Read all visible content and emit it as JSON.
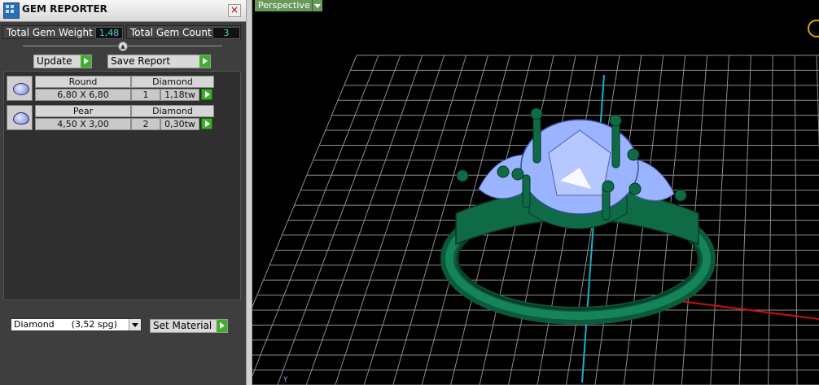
{
  "panel": {
    "title": "GEM REPORTER",
    "close_glyph": "×",
    "total_weight_label": "Total Gem Weight",
    "total_weight_value": "1,48",
    "total_count_label": "Total Gem Count",
    "total_count_value": "3",
    "update_label": "Update",
    "save_report_label": "Save Report"
  },
  "gems": [
    {
      "shape": "Round",
      "material": "Diamond",
      "size": "6,80 X 6,80",
      "count": "1",
      "weight": "1,18tw",
      "icon": "round-gem-icon"
    },
    {
      "shape": "Pear",
      "material": "Diamond",
      "size": "4,50 X 3,00",
      "count": "2",
      "weight": "0,30tw",
      "icon": "pear-gem-icon"
    }
  ],
  "material_select": {
    "selected": "Diamond      (3,52 spg)"
  },
  "set_material_label": "Set Material",
  "viewport": {
    "view_label": "Perspective",
    "axis_label": "Y",
    "grid_color": "#8c8c8c",
    "ring_color": "#0e6b45",
    "gem_color": "#9bb4ff",
    "x_axis_color": "#cc1111",
    "y_axis_color": "#11b5c5"
  }
}
